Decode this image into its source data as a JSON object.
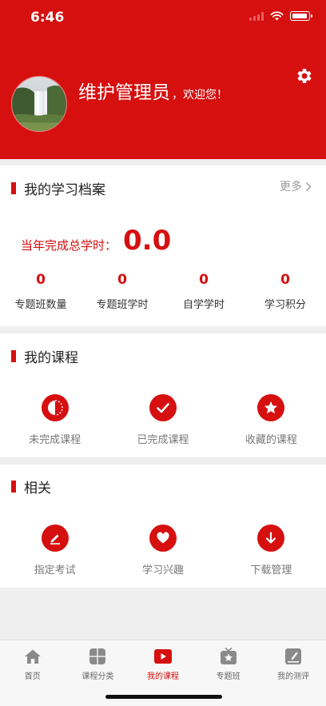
{
  "status_bar": {
    "time": "6:46"
  },
  "header": {
    "user_name": "维护管理员",
    "welcome": "，欢迎您！",
    "bg_color": "#d60f0f"
  },
  "archive": {
    "title": "我的学习档案",
    "more": "更多",
    "total_label": "当年完成总学时：",
    "total_value": "0.0",
    "stats": [
      {
        "value": "0",
        "label": "专题班数量"
      },
      {
        "value": "0",
        "label": "专题班学时"
      },
      {
        "value": "0",
        "label": "自学学时"
      },
      {
        "value": "0",
        "label": "学习积分"
      }
    ]
  },
  "courses": {
    "title": "我的课程",
    "items": [
      {
        "label": "未完成课程",
        "icon": "pie-progress-icon"
      },
      {
        "label": "已完成课程",
        "icon": "check-icon"
      },
      {
        "label": "收藏的课程",
        "icon": "star-icon"
      }
    ]
  },
  "related": {
    "title": "相关",
    "items": [
      {
        "label": "指定考试",
        "icon": "pen-icon"
      },
      {
        "label": "学习兴趣",
        "icon": "heart-icon"
      },
      {
        "label": "下载管理",
        "icon": "download-icon"
      }
    ]
  },
  "tabbar": {
    "active": "我的课程",
    "tabs": [
      {
        "label": "首页",
        "icon": "home-icon"
      },
      {
        "label": "课程分类",
        "icon": "grid-icon"
      },
      {
        "label": "我的课程",
        "icon": "play-icon"
      },
      {
        "label": "专题班",
        "icon": "tv-star-icon"
      },
      {
        "label": "我的测评",
        "icon": "note-icon"
      }
    ]
  }
}
